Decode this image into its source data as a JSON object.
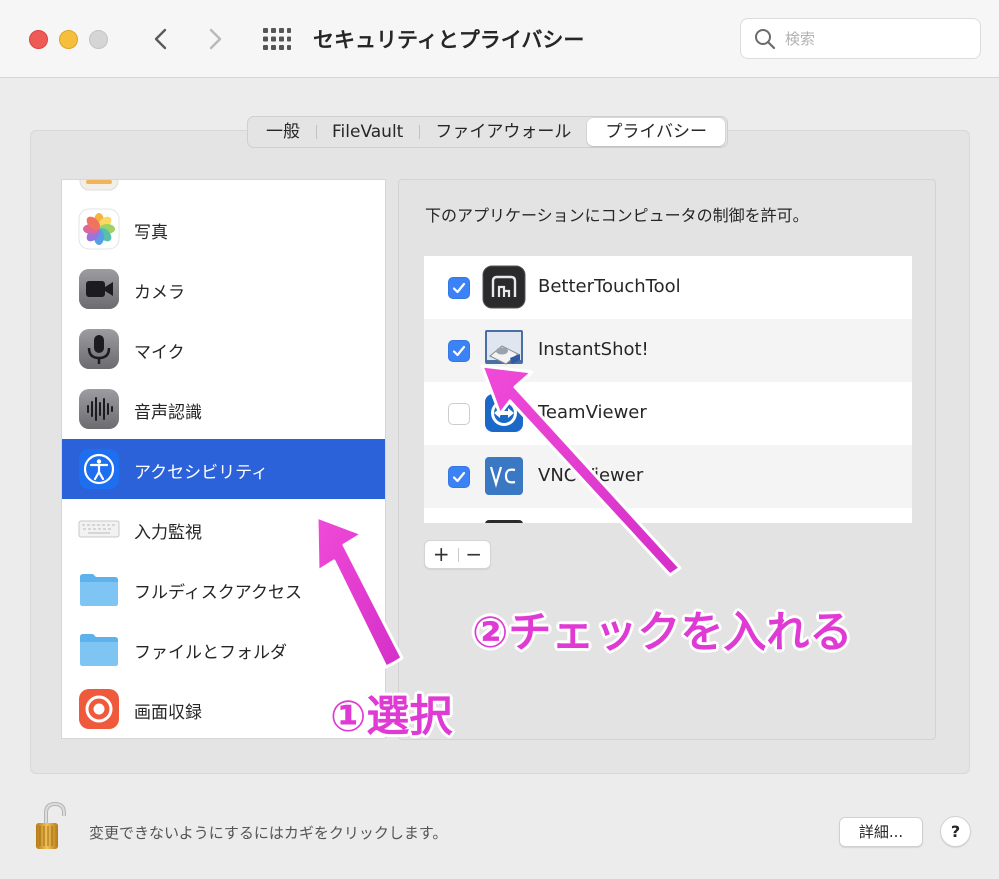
{
  "window": {
    "title": "セキュリティとプライバシー",
    "search_placeholder": "検索"
  },
  "tabs": [
    {
      "label": "一般",
      "active": false
    },
    {
      "label": "FileVault",
      "active": false
    },
    {
      "label": "ファイアウォール",
      "active": false
    },
    {
      "label": "プライバシー",
      "active": true
    }
  ],
  "sidebar": {
    "items": [
      {
        "label": "写真",
        "icon": "photos-icon"
      },
      {
        "label": "カメラ",
        "icon": "camera-icon"
      },
      {
        "label": "マイク",
        "icon": "microphone-icon"
      },
      {
        "label": "音声認識",
        "icon": "speech-recognition-icon"
      },
      {
        "label": "アクセシビリティ",
        "icon": "accessibility-icon",
        "selected": true
      },
      {
        "label": "入力監視",
        "icon": "keyboard-icon"
      },
      {
        "label": "フルディスクアクセス",
        "icon": "folder-icon"
      },
      {
        "label": "ファイルとフォルダ",
        "icon": "folder-icon"
      },
      {
        "label": "画面収録",
        "icon": "screen-recording-icon"
      }
    ]
  },
  "main": {
    "heading": "下のアプリケーションにコンピュータの制御を許可。",
    "apps": [
      {
        "label": "BetterTouchTool",
        "checked": true,
        "icon": "bettertouchtool-icon"
      },
      {
        "label": "InstantShot!",
        "checked": true,
        "icon": "instantshot-icon"
      },
      {
        "label": "TeamViewer",
        "checked": false,
        "icon": "teamviewer-icon"
      },
      {
        "label": "VNC Viewer",
        "checked": true,
        "icon": "vnc-viewer-icon"
      }
    ],
    "add_label": "+",
    "remove_label": "−"
  },
  "footer": {
    "lock_text": "変更できないようにするにはカギをクリックします。",
    "details_label": "詳細...",
    "help_label": "?"
  },
  "annotations": {
    "step1": "①選択",
    "step2": "②チェックを入れる",
    "color": "#e03ad4"
  },
  "colors": {
    "selection": "#2b62d9",
    "checkbox": "#3b82f6",
    "close": "#ee5b56",
    "minimize": "#f5be3b"
  }
}
